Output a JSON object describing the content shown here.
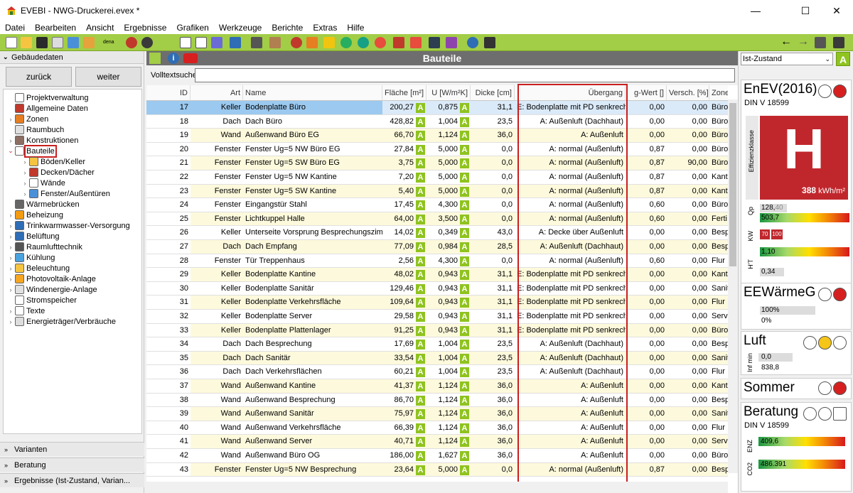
{
  "window": {
    "title": "EVEBI - NWG-Druckerei.evex *"
  },
  "menu": [
    "Datei",
    "Bearbeiten",
    "Ansicht",
    "Ergebnisse",
    "Grafiken",
    "Werkzeuge",
    "Berichte",
    "Extras",
    "Hilfe"
  ],
  "left": {
    "header": "Gebäudedaten",
    "back": "zurück",
    "forward": "weiter",
    "tree": [
      "Projektverwaltung",
      "Allgemeine Daten",
      "Zonen",
      "Raumbuch",
      "Konstruktionen",
      "Bauteile",
      "Böden/Keller",
      "Decken/Dächer",
      "Wände",
      "Fenster/Außentüren",
      "Wärmebrücken",
      "Beheizung",
      "Trinkwarmwasser-Versorgung",
      "Belüftung",
      "Raumlufttechnik",
      "Kühlung",
      "Beleuchtung",
      "Photovoltaik-Anlage",
      "Windenergie-Anlage",
      "Stromspeicher",
      "Texte",
      "Energieträger/Verbräuche"
    ],
    "bottom": [
      "Varianten",
      "Beratung",
      "Ergebnisse (Ist-Zustand, Varian..."
    ]
  },
  "main": {
    "title": "Bauteile",
    "search_label": "Volltextsuche",
    "search_value": "",
    "columns": [
      "ID",
      "Art",
      "Name",
      "Fläche [m²]",
      "U [W/m²K]",
      "Dicke [cm]",
      "Übergang",
      "g-Wert []",
      "Versch. [%]",
      "Zone"
    ],
    "rows": [
      [
        "17",
        "Keller",
        "Bodenplatte Büro",
        "200,27",
        "0,875",
        "31,1",
        "E: Bodenplatte mit PD senkrecht",
        "0,00",
        "0,00",
        "Büro"
      ],
      [
        "18",
        "Dach",
        "Dach Büro",
        "428,82",
        "1,004",
        "23,5",
        "A: Außenluft (Dachhaut)",
        "0,00",
        "0,00",
        "Büro"
      ],
      [
        "19",
        "Wand",
        "Außenwand Büro EG",
        "66,70",
        "1,124",
        "36,0",
        "A: Außenluft",
        "0,00",
        "0,00",
        "Büro"
      ],
      [
        "20",
        "Fenster",
        "Fenster Ug=5 NW Büro EG",
        "27,84",
        "5,000",
        "0,0",
        "A: normal (Außenluft)",
        "0,87",
        "0,00",
        "Büro"
      ],
      [
        "21",
        "Fenster",
        "Fenster Ug=5 SW Büro EG",
        "3,75",
        "5,000",
        "0,0",
        "A: normal (Außenluft)",
        "0,87",
        "90,00",
        "Büro"
      ],
      [
        "22",
        "Fenster",
        "Fenster Ug=5 NW Kantine",
        "7,20",
        "5,000",
        "0,0",
        "A: normal (Außenluft)",
        "0,87",
        "0,00",
        "Kant"
      ],
      [
        "23",
        "Fenster",
        "Fenster Ug=5 SW Kantine",
        "5,40",
        "5,000",
        "0,0",
        "A: normal (Außenluft)",
        "0,87",
        "0,00",
        "Kant"
      ],
      [
        "24",
        "Fenster",
        "Eingangstür Stahl",
        "17,45",
        "4,300",
        "0,0",
        "A: normal (Außenluft)",
        "0,60",
        "0,00",
        "Büro"
      ],
      [
        "25",
        "Fenster",
        "Lichtkuppel Halle",
        "64,00",
        "3,500",
        "0,0",
        "A: normal (Außenluft)",
        "0,60",
        "0,00",
        "Ferti"
      ],
      [
        "26",
        "Keller",
        "Unterseite Vorsprung Besprechungszimmer",
        "14,02",
        "0,349",
        "43,0",
        "A: Decke über Außenluft",
        "0,00",
        "0,00",
        "Besp"
      ],
      [
        "27",
        "Dach",
        "Dach Empfang",
        "77,09",
        "0,984",
        "28,5",
        "A: Außenluft (Dachhaut)",
        "0,00",
        "0,00",
        "Besp"
      ],
      [
        "28",
        "Fenster",
        "Tür Treppenhaus",
        "2,56",
        "4,300",
        "0,0",
        "A: normal (Außenluft)",
        "0,60",
        "0,00",
        "Flur"
      ],
      [
        "29",
        "Keller",
        "Bodenplatte Kantine",
        "48,02",
        "0,943",
        "31,1",
        "E: Bodenplatte mit PD senkrecht",
        "0,00",
        "0,00",
        "Kant"
      ],
      [
        "30",
        "Keller",
        "Bodenplatte Sanitär",
        "129,46",
        "0,943",
        "31,1",
        "E: Bodenplatte mit PD senkrecht",
        "0,00",
        "0,00",
        "Sanit"
      ],
      [
        "31",
        "Keller",
        "Bodenplatte Verkehrsfläche",
        "109,64",
        "0,943",
        "31,1",
        "E: Bodenplatte mit PD senkrecht",
        "0,00",
        "0,00",
        "Flur"
      ],
      [
        "32",
        "Keller",
        "Bodenplatte Server",
        "29,58",
        "0,943",
        "31,1",
        "E: Bodenplatte mit PD senkrecht",
        "0,00",
        "0,00",
        "Serv"
      ],
      [
        "33",
        "Keller",
        "Bodenplatte Plattenlager",
        "91,25",
        "0,943",
        "31,1",
        "E: Bodenplatte mit PD senkrecht",
        "0,00",
        "0,00",
        "Büro"
      ],
      [
        "34",
        "Dach",
        "Dach Besprechung",
        "17,69",
        "1,004",
        "23,5",
        "A: Außenluft (Dachhaut)",
        "0,00",
        "0,00",
        "Besp"
      ],
      [
        "35",
        "Dach",
        "Dach Sanitär",
        "33,54",
        "1,004",
        "23,5",
        "A: Außenluft (Dachhaut)",
        "0,00",
        "0,00",
        "Sanit"
      ],
      [
        "36",
        "Dach",
        "Dach Verkehrsflächen",
        "60,21",
        "1,004",
        "23,5",
        "A: Außenluft (Dachhaut)",
        "0,00",
        "0,00",
        "Flur"
      ],
      [
        "37",
        "Wand",
        "Außenwand Kantine",
        "41,37",
        "1,124",
        "36,0",
        "A: Außenluft",
        "0,00",
        "0,00",
        "Kant"
      ],
      [
        "38",
        "Wand",
        "Außenwand Besprechung",
        "86,70",
        "1,124",
        "36,0",
        "A: Außenluft",
        "0,00",
        "0,00",
        "Besp"
      ],
      [
        "39",
        "Wand",
        "Außenwand Sanitär",
        "75,97",
        "1,124",
        "36,0",
        "A: Außenluft",
        "0,00",
        "0,00",
        "Sanit"
      ],
      [
        "40",
        "Wand",
        "Außenwand Verkehrsfläche",
        "66,39",
        "1,124",
        "36,0",
        "A: Außenluft",
        "0,00",
        "0,00",
        "Flur"
      ],
      [
        "41",
        "Wand",
        "Außenwand Server",
        "40,71",
        "1,124",
        "36,0",
        "A: Außenluft",
        "0,00",
        "0,00",
        "Serv"
      ],
      [
        "42",
        "Wand",
        "Außenwand Büro OG",
        "186,00",
        "1,627",
        "36,0",
        "A: Außenluft",
        "0,00",
        "0,00",
        "Büro"
      ],
      [
        "43",
        "Fenster",
        "Fenster Ug=5 NW Besprechung",
        "23,64",
        "5,000",
        "0,0",
        "A: normal (Außenluft)",
        "0,87",
        "0,00",
        "Besp"
      ]
    ],
    "selected_row": 0,
    "rating": "A"
  },
  "right": {
    "state": "Ist-Zustand",
    "state_badge": "A",
    "enev": {
      "title": "EnEV(2016)",
      "sub": "DIN V 18599",
      "class": "H",
      "side": "Effizienzklasse",
      "value": "388",
      "unit": "kWh/m²",
      "qp_label": "Qp",
      "qp1": "128,",
      "qp1b": "40",
      "qp2": "503,7",
      "kw_label": "KW",
      "kw1": "70",
      "kw2": "100",
      "ht_label": "H'T",
      "ht1": "1,10",
      "ht2": "0,34"
    },
    "eew": {
      "title": "EEWärmeG",
      "v1": "100%",
      "v2": "0%"
    },
    "luft": {
      "title": "Luft",
      "lbl": "Inf min",
      "v1": "0,0",
      "v2": "838,8"
    },
    "sommer": {
      "title": "Sommer"
    },
    "beratung": {
      "title": "Beratung",
      "sub": "DIN V 18599",
      "enz_label": "ENZ",
      "enz": "409,6",
      "co2_label": "CO2",
      "co2": "486.391"
    }
  },
  "colors": {
    "toolbar": "#a2cd46",
    "rating": "#8fc31f",
    "selected": "#9bc9ef",
    "accent_red": "#c91f1f"
  }
}
